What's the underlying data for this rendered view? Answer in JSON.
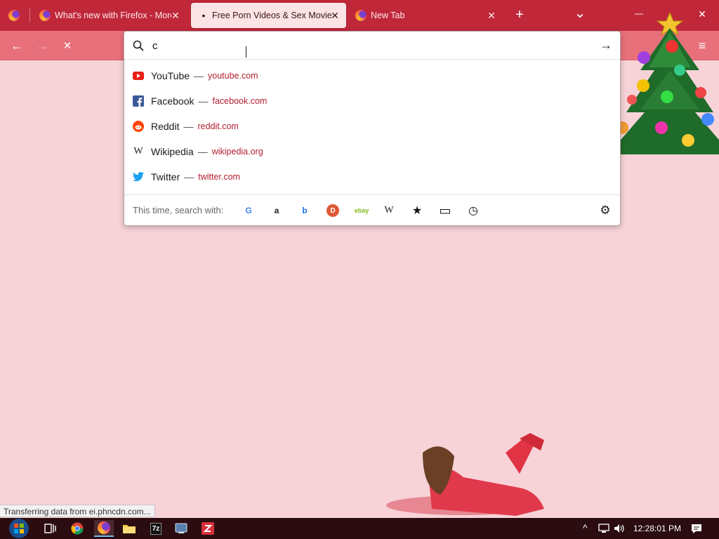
{
  "tabs": [
    {
      "label": "What's new with Firefox - More",
      "active": false
    },
    {
      "label": "Free Porn Videos & Sex Movies",
      "active": true
    },
    {
      "label": "New Tab",
      "active": false
    }
  ],
  "tabbar": {
    "new_tab_symbol": "+",
    "list_all_symbol": "⌄",
    "minimize_symbol": "—",
    "close_symbol": "✕",
    "tab_close_symbol": "✕",
    "loading_dot": "•"
  },
  "nav": {
    "back_symbol": "←",
    "forward_symbol": "→",
    "stop_symbol": "✕",
    "menu_symbol": "≡"
  },
  "urlbar": {
    "value": "c",
    "go_symbol": "→"
  },
  "suggestions": [
    {
      "title": "YouTube",
      "url": "youtube.com",
      "icon": "youtube-icon"
    },
    {
      "title": "Facebook",
      "url": "facebook.com",
      "icon": "facebook-icon"
    },
    {
      "title": "Reddit",
      "url": "reddit.com",
      "icon": "reddit-icon"
    },
    {
      "title": "Wikipedia",
      "url": "wikipedia.org",
      "icon": "wikipedia-icon"
    },
    {
      "title": "Twitter",
      "url": "twitter.com",
      "icon": "twitter-icon"
    }
  ],
  "suggestion_dash": "—",
  "search_with": {
    "label": "This time, search with:",
    "engines": [
      {
        "name": "google-icon",
        "glyph": "G",
        "color": "#4285f4"
      },
      {
        "name": "amazon-icon",
        "glyph": "a",
        "color": "#222222"
      },
      {
        "name": "bing-icon",
        "glyph": "b",
        "color": "#1a73e8"
      },
      {
        "name": "duckduckgo-icon",
        "glyph": "D",
        "color": "#de5833"
      },
      {
        "name": "ebay-icon",
        "glyph": "ebay",
        "color": "#86b817"
      },
      {
        "name": "wikipedia-search-icon",
        "glyph": "W",
        "color": "#222222"
      },
      {
        "name": "bookmarks-icon",
        "glyph": "★",
        "color": "#111111"
      },
      {
        "name": "tabs-icon",
        "glyph": "▭",
        "color": "#111111"
      },
      {
        "name": "history-icon",
        "glyph": "◷",
        "color": "#111111"
      }
    ],
    "settings_glyph": "⚙"
  },
  "status": {
    "text": "Transferring data from ei.phncdn.com..."
  },
  "taskbar": {
    "clock": "12:28:01 PM",
    "tray_up": "^",
    "sevenzip_label": "7z"
  },
  "colors": {
    "tabbar": "#c0283a",
    "navbar": "#e8707a",
    "page": "#f7d3d8",
    "url_link": "#b3202e",
    "taskbar": "#2b0d11"
  }
}
